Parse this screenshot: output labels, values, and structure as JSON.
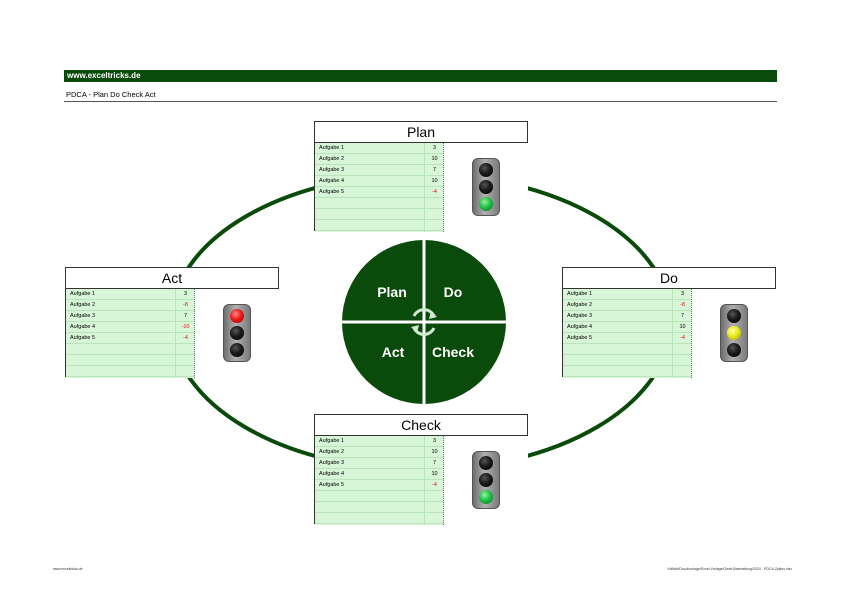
{
  "header": {
    "site": "www.exceltricks.de"
  },
  "subtitle": "PDCA - Plan Do Check Act",
  "colors": {
    "primary": "#0a4a0a",
    "table_bg": "#d7f6d7",
    "negative": "#e01010"
  },
  "cycle": {
    "q1": "Plan",
    "q2": "Do",
    "q3": "Act",
    "q4": "Check",
    "center_icon": "cycle-arrows-icon"
  },
  "panels": {
    "plan": {
      "title": "Plan",
      "light": "green",
      "tasks": [
        {
          "name": "Aufgabe 1",
          "value": "3"
        },
        {
          "name": "Aufgabe 2",
          "value": "10"
        },
        {
          "name": "Aufgabe 3",
          "value": "7"
        },
        {
          "name": "Aufgabe 4",
          "value": "10"
        },
        {
          "name": "Aufgabe 5",
          "value": "-4"
        }
      ]
    },
    "do": {
      "title": "Do",
      "light": "yellow",
      "tasks": [
        {
          "name": "Aufgabe 1",
          "value": "3"
        },
        {
          "name": "Aufgabe 2",
          "value": "-8"
        },
        {
          "name": "Aufgabe 3",
          "value": "7"
        },
        {
          "name": "Aufgabe 4",
          "value": "10"
        },
        {
          "name": "Aufgabe 5",
          "value": "-4"
        }
      ]
    },
    "check": {
      "title": "Check",
      "light": "green",
      "tasks": [
        {
          "name": "Aufgabe 1",
          "value": "3"
        },
        {
          "name": "Aufgabe 2",
          "value": "10"
        },
        {
          "name": "Aufgabe 3",
          "value": "7"
        },
        {
          "name": "Aufgabe 4",
          "value": "10"
        },
        {
          "name": "Aufgabe 5",
          "value": "-4"
        }
      ]
    },
    "act": {
      "title": "Act",
      "light": "red",
      "tasks": [
        {
          "name": "Aufgabe 1",
          "value": "3"
        },
        {
          "name": "Aufgabe 2",
          "value": "-8"
        },
        {
          "name": "Aufgabe 3",
          "value": "7"
        },
        {
          "name": "Aufgabe 4",
          "value": "-10"
        },
        {
          "name": "Aufgabe 5",
          "value": "-4"
        }
      ]
    }
  },
  "footer": {
    "left": "www.exceltricks.de",
    "right": "Vollbild/Druckvorlage/Excel-Vorlage/Gantt-Bearbeitung/2024 - PDCA-Zyklus.xlsx"
  }
}
